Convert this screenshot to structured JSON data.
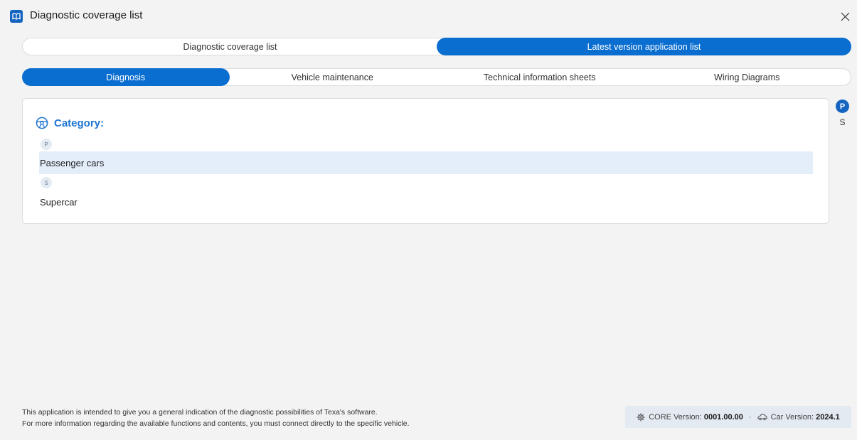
{
  "window": {
    "title": "Diagnostic coverage list",
    "app_icon": "book-icon",
    "close_icon": "close-icon"
  },
  "top_tabs": [
    {
      "label": "Diagnostic coverage list",
      "active": false
    },
    {
      "label": "Latest version application list",
      "active": true
    }
  ],
  "sub_tabs": [
    {
      "label": "Diagnosis",
      "active": true
    },
    {
      "label": "Vehicle maintenance",
      "active": false
    },
    {
      "label": "Technical information sheets",
      "active": false
    },
    {
      "label": "Wiring Diagrams",
      "active": false
    }
  ],
  "category": {
    "icon": "steering-wheel-icon",
    "label": "Category:",
    "groups": [
      {
        "letter": "P",
        "items": [
          {
            "label": "Passenger cars",
            "selected": true
          }
        ]
      },
      {
        "letter": "S",
        "items": [
          {
            "label": "Supercar",
            "selected": false
          }
        ]
      }
    ]
  },
  "index_rail": [
    "P",
    "S"
  ],
  "footer": {
    "disclaimer_line1": "This application is intended to give you a general indication of the diagnostic possibilities of Texa's software.",
    "disclaimer_line2": "For more information regarding the available functions and contents, you must connect directly to the specific vehicle.",
    "core_label": "CORE Version:",
    "core_value": "0001.00.00",
    "separator": "·",
    "car_label": "Car Version:",
    "car_value": "2024.1"
  },
  "colors": {
    "accent": "#0a6ed1",
    "selected_row": "#e3eefa",
    "category_label": "#1e74d2"
  }
}
